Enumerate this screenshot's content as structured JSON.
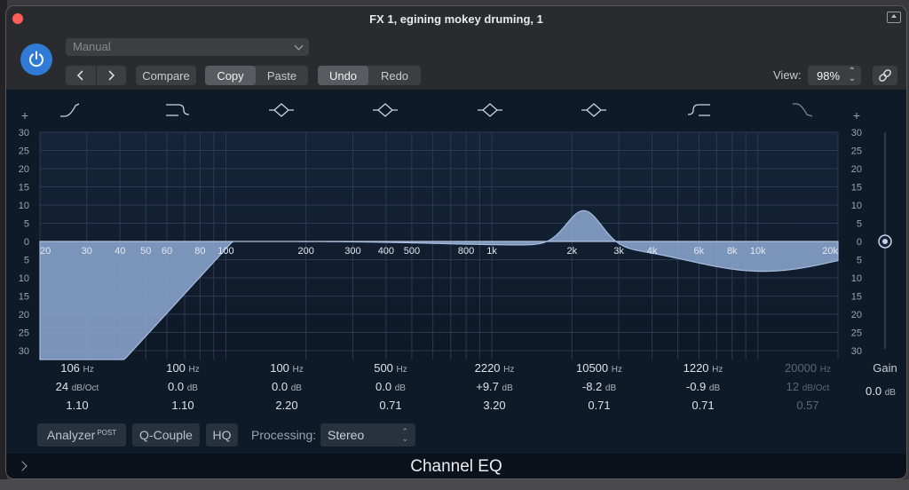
{
  "window": {
    "title": "FX 1, egining mokey druming, 1"
  },
  "toolbar": {
    "preset": "Manual",
    "compare": "Compare",
    "copy": "Copy",
    "paste": "Paste",
    "undo": "Undo",
    "redo": "Redo",
    "view_label": "View:",
    "view_value": "98%"
  },
  "graph": {
    "db_ticks_left": [
      "30",
      "25",
      "20",
      "15",
      "10",
      "5",
      "0",
      "5",
      "10",
      "15",
      "20",
      "25",
      "30"
    ],
    "db_ticks_right": [
      "30",
      "25",
      "20",
      "15",
      "10",
      "5",
      "0",
      "5",
      "10",
      "15",
      "20",
      "25",
      "30"
    ],
    "freq_labels": [
      "20",
      "30",
      "40",
      "50",
      "60",
      "80",
      "100",
      "200",
      "300",
      "400",
      "500",
      "800",
      "1k",
      "2k",
      "3k",
      "4k",
      "6k",
      "8k",
      "10k",
      "20k"
    ],
    "plus_left": "+",
    "plus_right": "+",
    "band_icons": [
      "lowcut-icon",
      "lowshelf-icon",
      "peak-icon",
      "peak-icon",
      "peak-icon",
      "peak-icon",
      "highshelf-icon",
      "highcut-icon"
    ]
  },
  "bands": [
    {
      "freq": "106",
      "freq_unit": "Hz",
      "gain": "24",
      "gain_unit": "dB/Oct",
      "q": "1.10",
      "enabled": true
    },
    {
      "freq": "100",
      "freq_unit": "Hz",
      "gain": "0.0",
      "gain_unit": "dB",
      "q": "1.10",
      "enabled": true
    },
    {
      "freq": "100",
      "freq_unit": "Hz",
      "gain": "0.0",
      "gain_unit": "dB",
      "q": "2.20",
      "enabled": true
    },
    {
      "freq": "500",
      "freq_unit": "Hz",
      "gain": "0.0",
      "gain_unit": "dB",
      "q": "0.71",
      "enabled": true
    },
    {
      "freq": "2220",
      "freq_unit": "Hz",
      "gain": "+9.7",
      "gain_unit": "dB",
      "q": "3.20",
      "enabled": true
    },
    {
      "freq": "10500",
      "freq_unit": "Hz",
      "gain": "-8.2",
      "gain_unit": "dB",
      "q": "0.71",
      "enabled": true
    },
    {
      "freq": "1220",
      "freq_unit": "Hz",
      "gain": "-0.9",
      "gain_unit": "dB",
      "q": "0.71",
      "enabled": true
    },
    {
      "freq": "20000",
      "freq_unit": "Hz",
      "gain": "12",
      "gain_unit": "dB/Oct",
      "q": "0.57",
      "enabled": false
    }
  ],
  "gain": {
    "label": "Gain",
    "value": "0.0",
    "unit": "dB"
  },
  "bottom": {
    "analyzer": "Analyzer",
    "analyzer_sup": "POST",
    "q_couple": "Q-Couple",
    "hq": "HQ",
    "processing_label": "Processing:",
    "processing_value": "Stereo"
  },
  "footer": {
    "plugin_name": "Channel EQ"
  },
  "colors": {
    "accent": "#2f7bd6",
    "curve_fill": "#8ea9d2",
    "background": "#0f1a28"
  }
}
